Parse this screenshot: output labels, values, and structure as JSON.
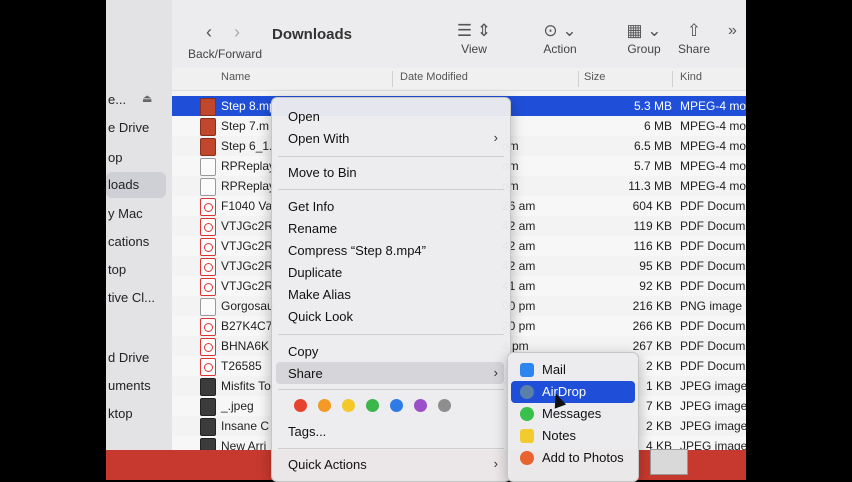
{
  "window": {
    "title": "Downloads"
  },
  "toolbar": {
    "back_forward": "Back/Forward",
    "view": "View",
    "action": "Action",
    "group": "Group",
    "share": "Share"
  },
  "sidebar": {
    "items": [
      {
        "label": "e..."
      },
      {
        "label": "e Drive"
      },
      {
        "label": "op"
      },
      {
        "label": "loads"
      },
      {
        "label": "y Mac"
      },
      {
        "label": "cations"
      },
      {
        "label": "top"
      },
      {
        "label": "tive Cl..."
      },
      {
        "label": "d Drive"
      },
      {
        "label": "uments"
      },
      {
        "label": "ktop"
      }
    ]
  },
  "columns": {
    "name": "Name",
    "date": "Date Modified",
    "size": "Size",
    "kind": "Kind"
  },
  "files": [
    {
      "name": "Step 8.mp",
      "date": "",
      "size": "5.3 MB",
      "kind": "MPEG-4 mo",
      "icon": "video"
    },
    {
      "name": "Step 7.m",
      "date": "",
      "size": "6 MB",
      "kind": "MPEG-4 mo",
      "icon": "video"
    },
    {
      "name": "Step 6_1.",
      "date": "om",
      "size": "6.5 MB",
      "kind": "MPEG-4 mo",
      "icon": "video"
    },
    {
      "name": "RPReplay",
      "date": "om",
      "size": "5.7 MB",
      "kind": "MPEG-4 mo",
      "icon": "doc"
    },
    {
      "name": "RPReplay",
      "date": "om",
      "size": "11.3 MB",
      "kind": "MPEG-4 mo",
      "icon": "doc"
    },
    {
      "name": "F1040 Va",
      "date": "26 am",
      "size": "604 KB",
      "kind": "PDF Docum",
      "icon": "pdf"
    },
    {
      "name": "VTJGc2R",
      "date": "42 am",
      "size": "119 KB",
      "kind": "PDF Docum",
      "icon": "pdf"
    },
    {
      "name": "VTJGc2R",
      "date": "42 am",
      "size": "116 KB",
      "kind": "PDF Docum",
      "icon": "pdf"
    },
    {
      "name": "VTJGc2R",
      "date": "42 am",
      "size": "95 KB",
      "kind": "PDF Docum",
      "icon": "pdf"
    },
    {
      "name": "VTJGc2R",
      "date": "41 am",
      "size": "92 KB",
      "kind": "PDF Docum",
      "icon": "pdf"
    },
    {
      "name": "Gorgosau",
      "date": "00 pm",
      "size": "216 KB",
      "kind": "PNG image",
      "icon": "doc"
    },
    {
      "name": "B27K4C7",
      "date": "20 pm",
      "size": "266 KB",
      "kind": "PDF Docum",
      "icon": "pdf"
    },
    {
      "name": "BHNA6K",
      "date": "4 pm",
      "size": "267 KB",
      "kind": "PDF Docum",
      "icon": "pdf"
    },
    {
      "name": "T26585",
      "date": "",
      "size": "2 KB",
      "kind": "PDF Docum",
      "icon": "pdf"
    },
    {
      "name": "Misfits To",
      "date": "",
      "size": "1 KB",
      "kind": "JPEG image",
      "icon": "img"
    },
    {
      "name": "_.jpeg",
      "date": "",
      "size": "7 KB",
      "kind": "JPEG image",
      "icon": "img"
    },
    {
      "name": "Insane C",
      "date": "",
      "size": "2 KB",
      "kind": "JPEG image",
      "icon": "img"
    },
    {
      "name": "New Arri",
      "date": "",
      "size": "4 KB",
      "kind": "JPEG image",
      "icon": "img"
    }
  ],
  "context_menu": {
    "open": "Open",
    "open_with": "Open With",
    "move_to_bin": "Move to Bin",
    "get_info": "Get Info",
    "rename": "Rename",
    "compress": "Compress “Step 8.mp4”",
    "duplicate": "Duplicate",
    "make_alias": "Make Alias",
    "quick_look": "Quick Look",
    "copy": "Copy",
    "share": "Share",
    "tags": "Tags...",
    "quick_actions": "Quick Actions",
    "tag_colors": [
      "#e8432f",
      "#f29a23",
      "#f3c92a",
      "#3cb54a",
      "#2f7be5",
      "#9b4fc9",
      "#8e8e8e"
    ]
  },
  "share_menu": {
    "items": [
      {
        "label": "Mail",
        "color": "#2d86f0"
      },
      {
        "label": "AirDrop",
        "color": "#5a7fa8"
      },
      {
        "label": "Messages",
        "color": "#37c04a"
      },
      {
        "label": "Notes",
        "color": "#f2cc2e"
      },
      {
        "label": "Add to Photos",
        "color": "#e8632f"
      }
    ]
  },
  "colors": {
    "selection": "#1f4fd8"
  }
}
